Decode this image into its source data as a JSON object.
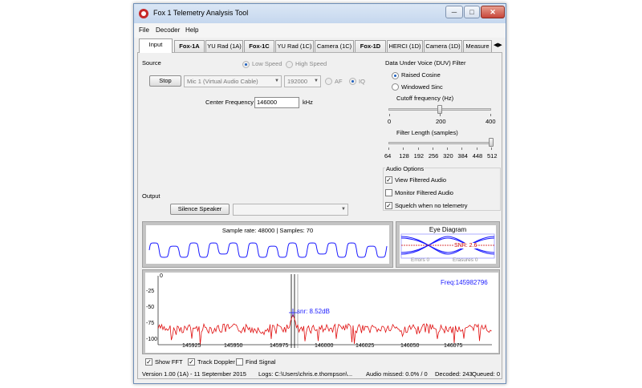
{
  "window": {
    "title": "Fox 1 Telemetry Analysis Tool",
    "controls": {
      "minimize": "─",
      "maximize": "□",
      "close": "✕"
    }
  },
  "menu": [
    "File",
    "Decoder",
    "Help"
  ],
  "tabs": [
    {
      "label": "Input",
      "bold": false,
      "active": true
    },
    {
      "label": "Fox-1A",
      "bold": true
    },
    {
      "label": "YU Rad (1A)",
      "bold": false
    },
    {
      "label": "Fox-1C",
      "bold": true
    },
    {
      "label": "YU Rad (1C)",
      "bold": false
    },
    {
      "label": "Camera (1C)",
      "bold": false
    },
    {
      "label": "Fox-1D",
      "bold": true
    },
    {
      "label": "HERCI (1D)",
      "bold": false
    },
    {
      "label": "Camera (1D)",
      "bold": false
    },
    {
      "label": "Measure",
      "bold": false
    }
  ],
  "tab_scroll": {
    "left": "◀",
    "right": "▶"
  },
  "source": {
    "heading": "Source",
    "low_speed": "Low Speed",
    "high_speed": "High Speed",
    "stop_button": "Stop",
    "device": "Mic 1 (Virtual Audio Cable)",
    "sample_rate": "192000",
    "af": "AF",
    "iq": "IQ",
    "center_freq_label": "Center Frequency",
    "center_freq_value": "146000",
    "center_freq_unit": "kHz"
  },
  "duv_filter": {
    "heading": "Data Under Voice (DUV) Filter",
    "raised_cosine": "Raised Cosine",
    "windowed_sinc": "Windowed Sinc",
    "cutoff_label": "Cutoff frequency (Hz)",
    "cutoff_ticks": [
      "0",
      "200",
      "400"
    ],
    "cutoff_value": 200,
    "filter_length_label": "Filter Length (samples)",
    "filter_length_ticks": [
      "64",
      "128",
      "192",
      "256",
      "320",
      "384",
      "448",
      "512"
    ],
    "filter_length_value": 512
  },
  "audio_options": {
    "heading": "Audio Options",
    "view_filtered": "View Filtered Audio",
    "view_filtered_checked": true,
    "monitor_filtered": "Monitor Filtered Audio",
    "monitor_filtered_checked": false,
    "squelch": "Squelch when no telemetry",
    "squelch_checked": true
  },
  "output": {
    "heading": "Output",
    "silence_button": "Silence Speaker"
  },
  "audio_graph": {
    "title": "Sample rate: 48000 | Samples: 70",
    "color": "#1a1aff"
  },
  "eye_diagram": {
    "title": "Eye Diagram",
    "snr": "SNR: 2.6",
    "errors": "Errors  0",
    "erasures": "Erasures  0",
    "color": "#1a1aff"
  },
  "fft": {
    "freq_readout": "Freq:145982796",
    "snr_readout": "snr: 8.52dB",
    "y_ticks": [
      "0",
      "-25",
      "-50",
      "-75",
      "-100"
    ],
    "x_ticks": [
      "145925",
      "145950",
      "145975",
      "146000",
      "146025",
      "146050",
      "146075"
    ],
    "trace_color": "#e01010",
    "text_color": "#1a1aff"
  },
  "fft_options": {
    "show_fft": "Show FFT",
    "show_fft_checked": true,
    "track_doppler": "Track Doppler",
    "track_doppler_checked": true,
    "find_signal": "Find Signal",
    "find_signal_checked": false
  },
  "status": {
    "version": "Version 1.00 (1A)  - 11 September 2015",
    "logs": "Logs: C:\\Users\\chris.e.thompson\\...",
    "audio_missed": "Audio missed: 0.0% / 0",
    "decoded": "Decoded: 243",
    "queued": "Queued: 0"
  }
}
